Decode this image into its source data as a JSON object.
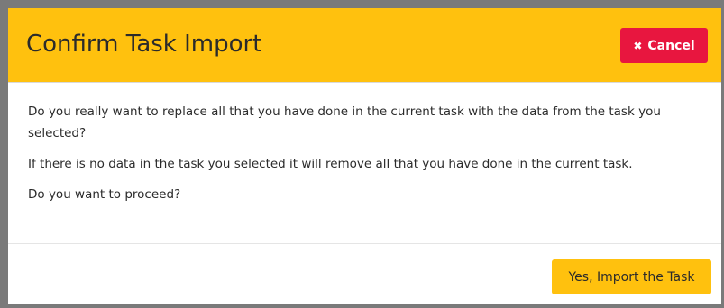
{
  "dialog": {
    "title": "Confirm Task Import",
    "cancel": {
      "icon": "close-icon",
      "icon_glyph": "✖",
      "label": "Cancel",
      "color": "#e8163f"
    },
    "body": {
      "paragraphs": [
        "Do you really want to replace all that you have done in the current task with the data from the task you selected?",
        "If there is no data in the task you selected it will remove all that you have done in the current task.",
        "Do you want to proceed?"
      ]
    },
    "confirm": {
      "label": "Yes, Import the Task",
      "color": "#ffc10e"
    },
    "header_color": "#ffc10e"
  }
}
